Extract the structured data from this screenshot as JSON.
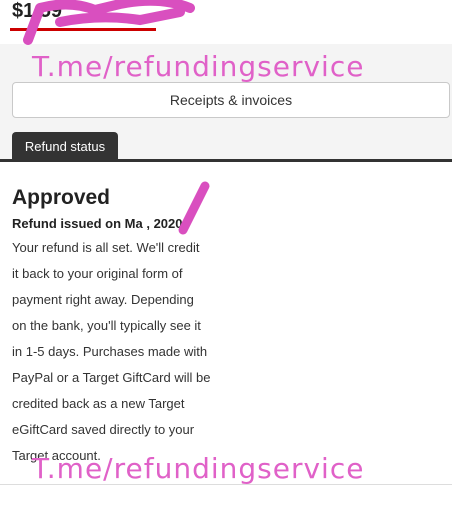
{
  "order": {
    "amount_text": "$1 59"
  },
  "actions": {
    "receipts_label": "Receipts & invoices"
  },
  "tabs": [
    {
      "label": "Refund status",
      "active": true
    }
  ],
  "refund": {
    "status": "Approved",
    "issued_line": "Refund issued on Ma , 2020.",
    "body": "Your refund is all set. We'll credit\nit back to your original form of\npayment right away. Depending\non the bank, you'll typically see it\nin 1-5 days. Purchases made with\nPayPal or a Target GiftCard will be\ncredited back as a new Target\neGiftCard saved directly to your\nTarget account."
  },
  "watermark": {
    "text_top": "T.me/refundingservice",
    "text_bottom": "T.me/refundingservice"
  },
  "colors": {
    "accent_red": "#cc0000",
    "tab_dark": "#333333",
    "scribble_pink": "#d94fbf"
  }
}
